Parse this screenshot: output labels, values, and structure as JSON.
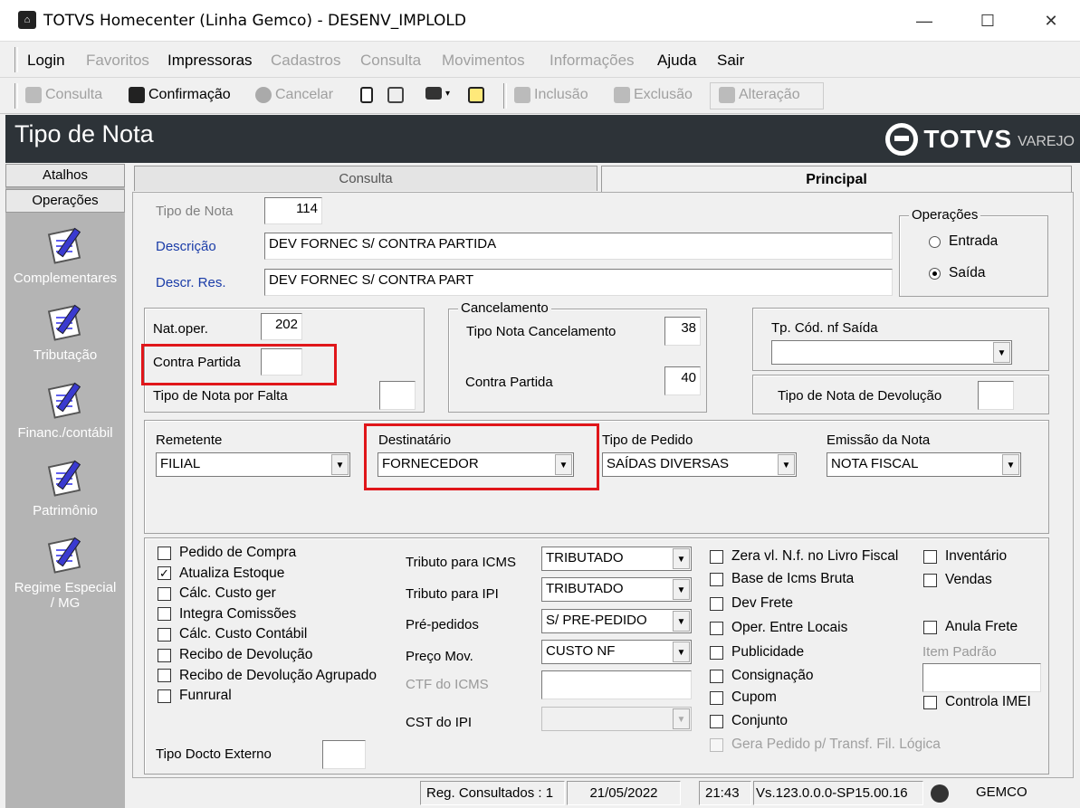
{
  "window": {
    "title": "TOTVS Homecenter (Linha Gemco) - DESENV_IMPLOLD",
    "min": "—",
    "max": "☐",
    "close": "✕"
  },
  "menu": [
    "Login",
    "Favoritos",
    "Impressoras",
    "Cadastros",
    "Consulta",
    "Movimentos",
    "Informações",
    "Ajuda",
    "Sair"
  ],
  "toolbar": {
    "consulta": "Consulta",
    "confirmacao": "Confirmação",
    "cancelar": "Cancelar",
    "inclusao": "Inclusão",
    "exclusao": "Exclusão",
    "alteracao": "Alteração"
  },
  "header": {
    "title": "Tipo de Nota",
    "brand": "TOTVS",
    "brand_sub": "VAREJO"
  },
  "sidebar": {
    "tabs": [
      "Atalhos",
      "Operações"
    ],
    "items": [
      "Complementares",
      "Tributação",
      "Financ./contábil",
      "Patrimônio",
      "Regime Especial / MG"
    ]
  },
  "tabs": {
    "consulta": "Consulta",
    "principal": "Principal"
  },
  "form": {
    "tipo_nota_label": "Tipo de Nota",
    "tipo_nota": "114",
    "descricao_label": "Descrição",
    "descricao": "DEV FORNEC S/ CONTRA PARTIDA",
    "descr_res_label": "Descr. Res.",
    "descr_res": "DEV FORNEC S/ CONTRA PART",
    "operacoes_label": "Operações",
    "entrada": "Entrada",
    "saida": "Saída",
    "nat_oper_label": "Nat.oper.",
    "nat_oper": "202",
    "contra_partida_label": "Contra Partida",
    "contra_partida": "",
    "tipo_nota_falta_label": "Tipo de Nota por Falta",
    "tipo_nota_falta": "",
    "cancelamento_label": "Cancelamento",
    "tipo_nota_cancel_label": "Tipo Nota Cancelamento",
    "tipo_nota_cancel": "38",
    "cancel_contra_partida_label": "Contra Partida",
    "cancel_contra_partida": "40",
    "tp_cod_nf_saida_label": "Tp. Cód. nf Saída",
    "tp_cod_nf_saida": "",
    "tipo_nota_devolucao_label": "Tipo de Nota de Devolução",
    "tipo_nota_devolucao": "",
    "remetente_label": "Remetente",
    "remetente": "FILIAL",
    "destinatario_label": "Destinatário",
    "destinatario": "FORNECEDOR",
    "tipo_pedido_label": "Tipo de Pedido",
    "tipo_pedido": "SAÍDAS DIVERSAS",
    "emissao_label": "Emissão da Nota",
    "emissao": "NOTA FISCAL",
    "tributo_icms_label": "Tributo para ICMS",
    "tributo_icms": "TRIBUTADO",
    "tributo_ipi_label": "Tributo para IPI",
    "tributo_ipi": "TRIBUTADO",
    "pre_pedidos_label": "Pré-pedidos",
    "pre_pedidos": "S/ PRE-PEDIDO",
    "preco_mov_label": "Preço Mov.",
    "preco_mov": "CUSTO NF",
    "ctf_icms_label": "CTF do ICMS",
    "cst_ipi_label": "CST do IPI",
    "item_padrao_label": "Item Padrão",
    "tipo_docto_externo_label": "Tipo Docto Externo"
  },
  "checks_left": [
    {
      "label": "Pedido de Compra",
      "checked": ""
    },
    {
      "label": "Atualiza Estoque",
      "checked": "✓"
    },
    {
      "label": "Cálc. Custo ger",
      "checked": ""
    },
    {
      "label": "Integra Comissões",
      "checked": ""
    },
    {
      "label": "Cálc. Custo Contábil",
      "checked": ""
    },
    {
      "label": "Recibo de Devolução",
      "checked": ""
    },
    {
      "label": "Recibo de Devolução Agrupado",
      "checked": ""
    },
    {
      "label": "Funrural",
      "checked": ""
    }
  ],
  "checks_mid": [
    {
      "label": "Zera vl. N.f. no Livro Fiscal"
    },
    {
      "label": "Base de Icms Bruta"
    },
    {
      "label": "Dev Frete"
    },
    {
      "label": "Oper. Entre Locais"
    },
    {
      "label": "Publicidade"
    },
    {
      "label": "Consignação"
    },
    {
      "label": "Cupom"
    },
    {
      "label": "Conjunto"
    },
    {
      "label": "Gera Pedido p/ Transf. Fil. Lógica"
    }
  ],
  "checks_right": {
    "inventario": "Inventário",
    "vendas": "Vendas",
    "anula_frete": "Anula Frete",
    "controla_imei": "Controla IMEI"
  },
  "status": {
    "reg": "Reg. Consultados : 1",
    "date": "21/05/2022",
    "time": "21:43",
    "version": "Vs.123.0.0.0-SP15.00.16",
    "user": "GEMCO"
  }
}
